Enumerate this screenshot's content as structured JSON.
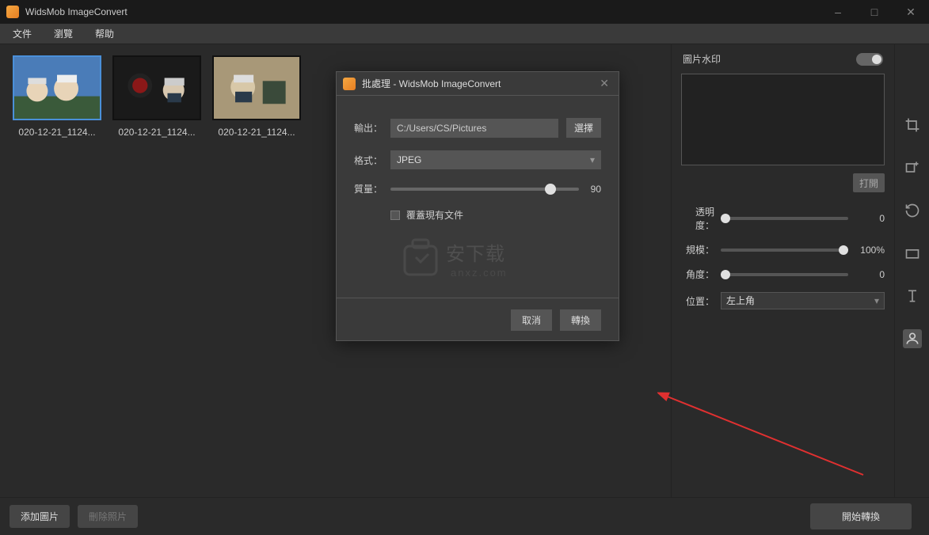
{
  "window": {
    "title": "WidsMob ImageConvert",
    "minimize": "–",
    "maximize": "□",
    "close": "✕"
  },
  "menu": {
    "file": "文件",
    "browse": "瀏覽",
    "help": "帮助"
  },
  "thumbs": [
    {
      "label": "020-12-21_1124..."
    },
    {
      "label": "020-12-21_1124..."
    },
    {
      "label": "020-12-21_1124..."
    }
  ],
  "dialog": {
    "title": "批處理 - WidsMob ImageConvert",
    "output_label": "輸出：",
    "output_path": "C:/Users/CS/Pictures",
    "choose": "選擇",
    "format_label": "格式：",
    "format_value": "JPEG",
    "quality_label": "質量：",
    "quality_value": "90",
    "overwrite": "覆蓋現有文件",
    "logo_text": "安下载",
    "logo_sub": "anxz.com",
    "cancel": "取消",
    "convert": "轉換"
  },
  "panel": {
    "header": "圖片水印",
    "open": "打開",
    "opacity_label": "透明度：",
    "opacity_value": "0",
    "scale_label": "規模：",
    "scale_value": "100%",
    "angle_label": "角度：",
    "angle_value": "0",
    "position_label": "位置：",
    "position_value": "左上角"
  },
  "bottom": {
    "add": "添加圖片",
    "delete": "刪除照片",
    "start": "開始轉換"
  }
}
